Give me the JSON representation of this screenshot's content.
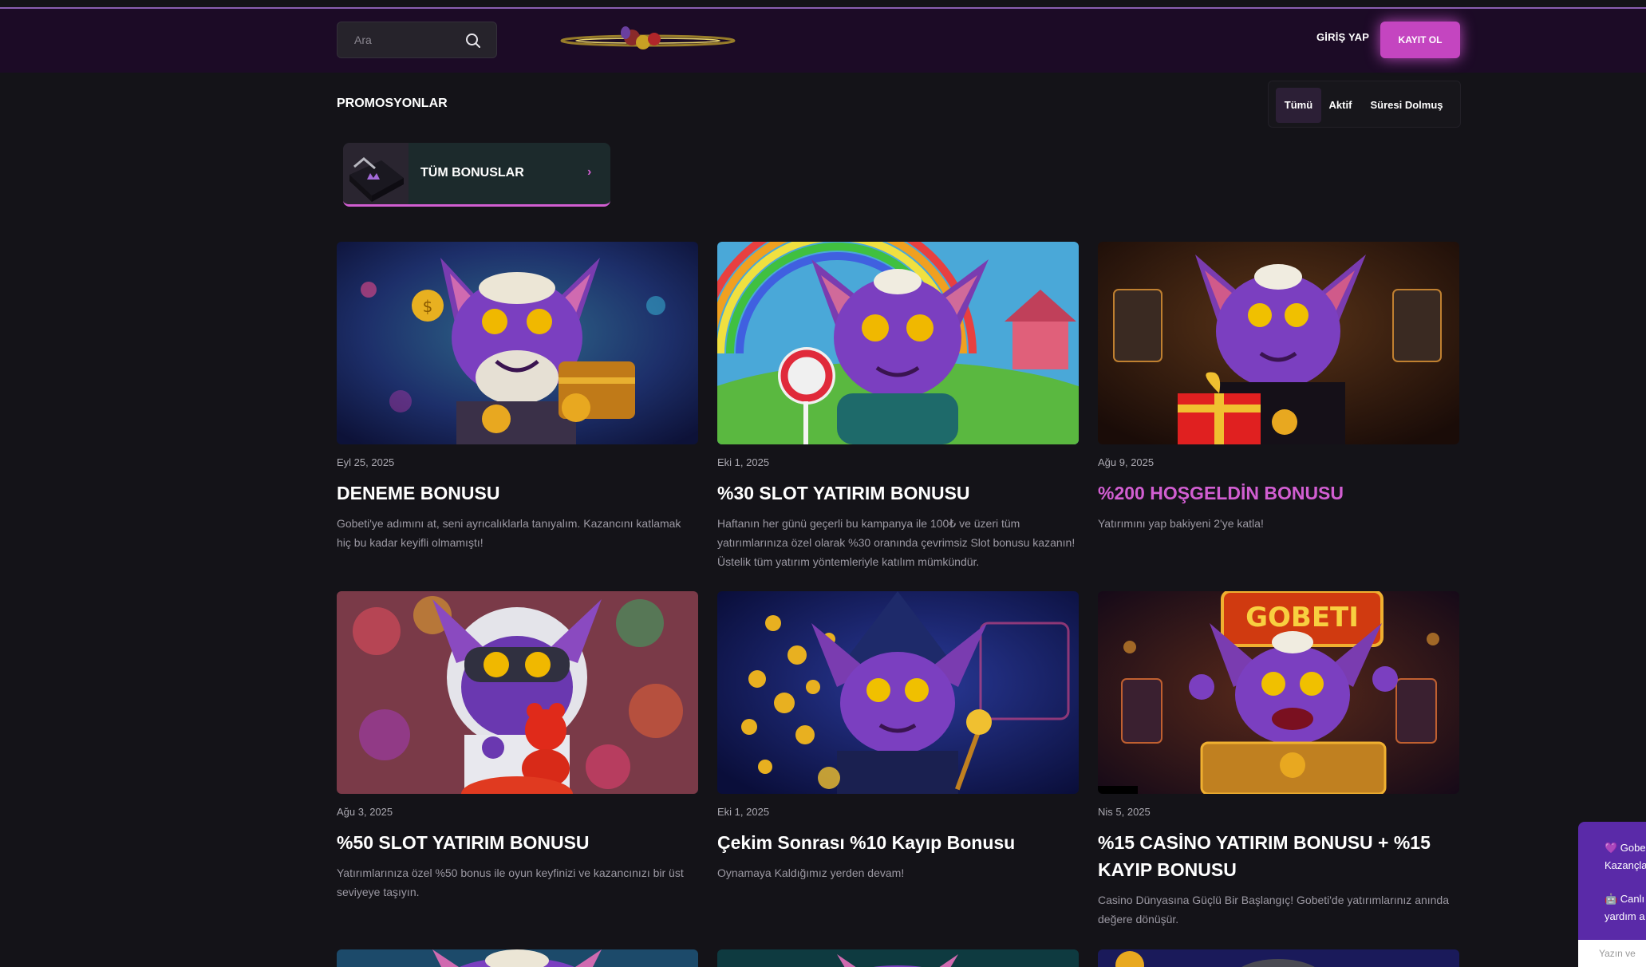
{
  "header": {
    "search_placeholder": "Ara",
    "login_label": "GİRİŞ YAP",
    "register_label": "KAYIT OL"
  },
  "page": {
    "title": "PROMOSYONLAR",
    "filters": [
      "Tümü",
      "Aktif",
      "Süresi Dolmuş"
    ],
    "all_bonuses_label": "TÜM BONUSLAR"
  },
  "promotions": [
    {
      "date": "Eyl 25, 2025",
      "title": "DENEME BONUSU",
      "description": "Gobeti'ye adımını at, seni ayrıcalıklarla tanıyalım. Kazancını katlamak hiç bu kadar keyifli olmamıştı!"
    },
    {
      "date": "Eki 1, 2025",
      "title": "%30 SLOT YATIRIM BONUSU",
      "description": "Haftanın her günü geçerli bu kampanya ile 100₺ ve üzeri tüm yatırımlarınıza özel olarak %30 oranında çevrimsiz Slot bonusu kazanın! Üstelik tüm yatırım yöntemleriyle katılım mümkündür."
    },
    {
      "date": "Ağu 9, 2025",
      "title": "%200 HOŞGELDİN BONUSU",
      "description": "Yatırımını yap bakiyeni 2'ye katla!"
    },
    {
      "date": "Ağu 3, 2025",
      "title": "%50 SLOT YATIRIM BONUSU",
      "description": "Yatırımlarınıza özel %50 bonus ile oyun keyfinizi ve kazancınızı bir üst seviyeye taşıyın."
    },
    {
      "date": "Eki 1, 2025",
      "title": "Çekim Sonrası %10 Kayıp Bonusu",
      "description": "Oynamaya Kaldığımız yerden devam!"
    },
    {
      "date": "Nis 5, 2025",
      "title": "%15 CASİNO YATIRIM BONUSU + %15 KAYIP BONUSU",
      "description": "Casino Dünyasına Güçlü Bir Başlangıç! Gobeti'de yatırımlarınız anında değere dönüşür."
    }
  ],
  "chat": {
    "line1a": "💜 Gobe",
    "line1b": "Kazançla",
    "line2a": "🤖 Canlı",
    "line2b": "yardım a",
    "input_placeholder": "Yazın ve"
  },
  "colors": {
    "accent": "#d15ed1",
    "background": "#141318",
    "header": "#1c0b26"
  },
  "icons": [
    "search-icon",
    "chevron-right-icon"
  ]
}
